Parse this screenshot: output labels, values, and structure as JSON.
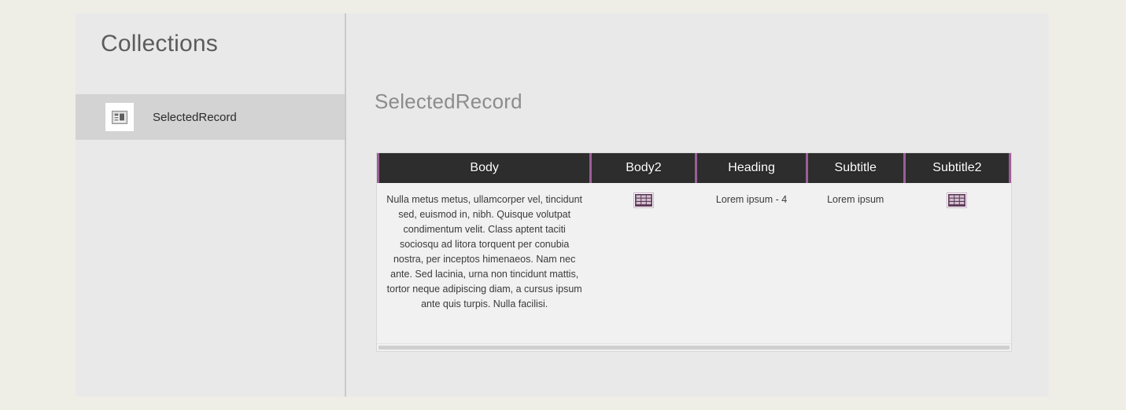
{
  "sidebar": {
    "title": "Collections",
    "items": [
      {
        "label": "SelectedRecord",
        "icon": "record-card-icon",
        "selected": true
      }
    ]
  },
  "main": {
    "title": "SelectedRecord",
    "table": {
      "columns": [
        "Body",
        "Body2",
        "Heading",
        "Subtitle",
        "Subtitle2"
      ],
      "rows": [
        {
          "Body": "Nulla metus metus, ullamcorper vel, tincidunt sed, euismod in, nibh. Quisque volutpat condimentum velit. Class aptent taciti sociosqu ad litora torquent per conubia nostra, per inceptos himenaeos. Nam nec ante. Sed lacinia, urna non tincidunt mattis, tortor neque adipiscing diam, a cursus ipsum ante quis turpis. Nulla facilisi.",
          "Body2": "",
          "Body2_icon": "table-grid-icon",
          "Heading": "Lorem ipsum - 4",
          "Subtitle": "Lorem ipsum",
          "Subtitle2": "",
          "Subtitle2_icon": "table-grid-icon"
        }
      ],
      "has_horizontal_scrollbar": true
    }
  },
  "colors": {
    "page_background": "#eeeee6",
    "panel_background": "#e9e9e9",
    "sidebar_selected": "#d3d3d3",
    "header_background": "#2d2d2d",
    "header_divider_accent": "#9b5f96",
    "cell_background": "#f1f1f1",
    "title_text": "#5c5c5c",
    "record_title_text": "#8c8c8c",
    "icon_purple": "#6b3f66"
  }
}
